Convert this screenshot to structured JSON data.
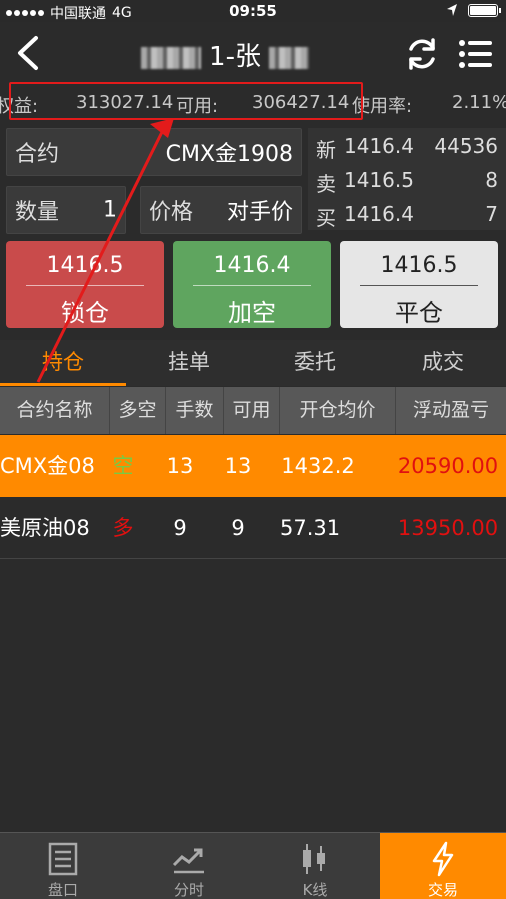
{
  "status_bar": {
    "carrier": "中国联通",
    "network": "4G",
    "time": "09:55"
  },
  "nav": {
    "title": "1-张"
  },
  "equity": {
    "equity_label": "权益:",
    "equity_value": "313027.14",
    "available_label": "可用:",
    "available_value": "306427.14",
    "usage_label": "使用率:",
    "usage_value": "2.11%"
  },
  "order_form": {
    "contract_label": "合约",
    "contract_value": "CMX金1908",
    "qty_label": "数量",
    "qty_value": "1",
    "price_label": "价格",
    "price_value": "对手价"
  },
  "quote_book": {
    "rows": [
      {
        "label": "新",
        "price": "1416.4",
        "volume": "44536"
      },
      {
        "label": "卖",
        "price": "1416.5",
        "volume": "8"
      },
      {
        "label": "买",
        "price": "1416.4",
        "volume": "7"
      }
    ]
  },
  "actions": {
    "lock": {
      "price": "1416.5",
      "label": "锁仓",
      "color": "#c94b4b"
    },
    "short": {
      "price": "1416.4",
      "label": "加空",
      "color": "#5fa55f"
    },
    "close": {
      "price": "1416.5",
      "label": "平仓",
      "color": "#e6e6e6"
    }
  },
  "tabs": [
    {
      "label": "持仓",
      "active": true
    },
    {
      "label": "挂单",
      "active": false
    },
    {
      "label": "委托",
      "active": false
    },
    {
      "label": "成交",
      "active": false
    }
  ],
  "table": {
    "headers": [
      "合约名称",
      "多空",
      "手数",
      "可用",
      "开仓均价",
      "浮动盈亏"
    ],
    "rows": [
      {
        "name": "CMX金08",
        "side": "空",
        "lots": "13",
        "available": "13",
        "avg_price": "1432.2",
        "pnl": "20590.00",
        "selected": true
      },
      {
        "name": "美原油08",
        "side": "多",
        "lots": "9",
        "available": "9",
        "avg_price": "57.31",
        "pnl": "13950.00",
        "selected": false
      }
    ]
  },
  "bottom_tabs": [
    {
      "label": "盘口",
      "icon": "orderbook-icon",
      "active": false
    },
    {
      "label": "分时",
      "icon": "timeshare-chart-icon",
      "active": false
    },
    {
      "label": "K线",
      "icon": "candlestick-icon",
      "active": false
    },
    {
      "label": "交易",
      "icon": "lightning-icon",
      "active": true
    }
  ],
  "colors": {
    "accent": "#ff8a00",
    "loss_red": "#e01010",
    "short_green": "#7ac943",
    "long_red": "#e01010",
    "annotation_red": "#e31b1b"
  }
}
